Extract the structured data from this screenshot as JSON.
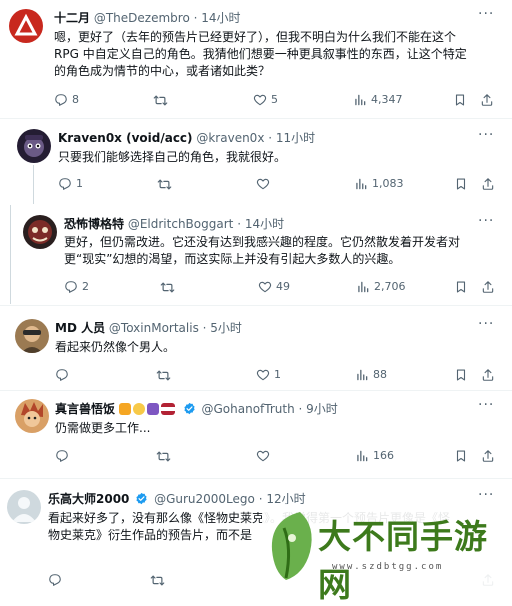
{
  "tweets": [
    {
      "name": "十二月",
      "handle": "@TheDezembro",
      "time": "· 14小时",
      "lines": [
        "嗯，更好了（去年的预告片已经更好了），但我不明白为什么我们不能在这个",
        "RPG 中自定义自己的角色。我猜他们想要一种更具叙事性的东西，让这个特定",
        "的角色成为情节的中心，或者诸如此类？"
      ],
      "replies": "8",
      "retweets": "",
      "likes": "5",
      "views": "4,347"
    },
    {
      "name": "Kraven0x (void/acc)",
      "handle": "@kraven0x",
      "time": "· 11小时",
      "lines": [
        "只要我们能够选择自己的角色，我就很好。"
      ],
      "replies": "1",
      "retweets": "",
      "likes": "",
      "views": "1,083"
    },
    {
      "name": "恐怖博格特",
      "handle": "@EldritchBoggart",
      "time": "· 14小时",
      "lines": [
        "更好，但仍需改进。它还没有达到我感兴趣的程度。它仍然散发着开发者对",
        "更“现实”幻想的渴望，而这实际上并没有引起大多数人的兴趣。"
      ],
      "replies": "2",
      "retweets": "",
      "likes": "49",
      "views": "2,706"
    },
    {
      "name": "MD 人员",
      "handle": "@ToxinMortalis",
      "time": "· 5小时",
      "lines": [
        "看起来仍然像个男人。"
      ],
      "replies": "",
      "retweets": "",
      "likes": "1",
      "views": "88"
    },
    {
      "name": "真言兽悟饭",
      "handle": "@GohanofTruth",
      "time": "· 9小时",
      "lines": [
        "仍需做更多工作..."
      ],
      "replies": "",
      "retweets": "",
      "likes": "",
      "views": "166"
    },
    {
      "name": "乐高大师2000",
      "handle": "@Guru2000Lego",
      "time": "· 12小时",
      "lines": [
        "看起来好多了，没有那么像《怪物史莱克》。我觉得第一个预告片更像是《怪",
        "物史莱克》衍生作品的预告片，而不是"
      ],
      "replies": "",
      "retweets": "",
      "likes": "",
      "views": ""
    }
  ],
  "watermark": {
    "text": "大不同手游网",
    "url": "www.szdbtgg.com"
  },
  "colors": {
    "icon": "#536471",
    "divider": "#eff3f4",
    "thread_line": "#cfd9de",
    "verified": "#1d9bf0"
  }
}
